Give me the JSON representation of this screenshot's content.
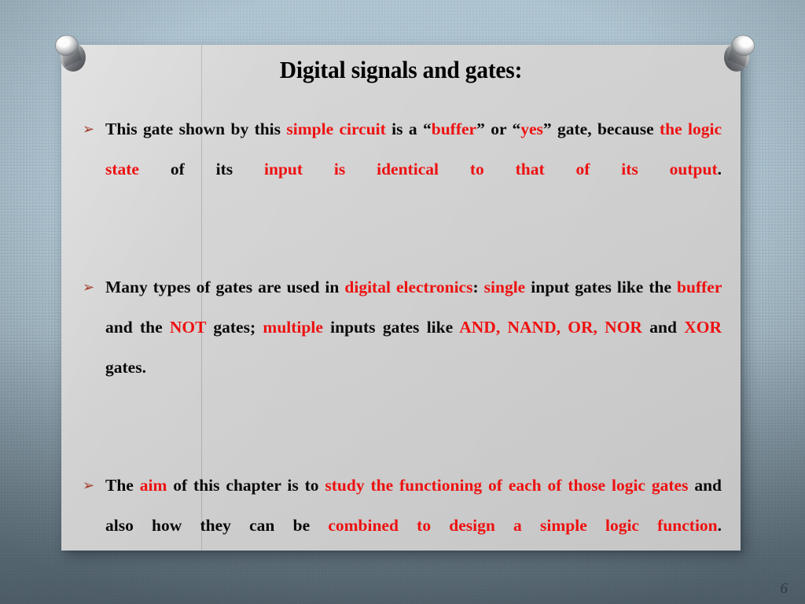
{
  "slide": {
    "title": "Digital signals and gates:",
    "page_number": "6",
    "panel_color": "#cfcfcf",
    "background_color": "#a9c0cd",
    "accent_red": "#ee1111",
    "bullet_marker": "➢",
    "bullet_marker_color": "#a33a28"
  },
  "bullets": [
    {
      "id": "bullet-1",
      "plain": "This gate shown by this simple circuit is a “buffer” or “yes” gate, because the logic state of its input is identical to that of its output.",
      "runs": [
        {
          "text": "This gate shown by this ",
          "color": "black"
        },
        {
          "text": "simple circuit",
          "color": "red"
        },
        {
          "text": " is a “",
          "color": "black"
        },
        {
          "text": "buffer",
          "color": "red"
        },
        {
          "text": "” or “",
          "color": "black"
        },
        {
          "text": "yes",
          "color": "red"
        },
        {
          "text": "” gate, because ",
          "color": "black"
        },
        {
          "text": "the logic state",
          "color": "red"
        },
        {
          "text": " of its ",
          "color": "black"
        },
        {
          "text": "input is identical to that of its output",
          "color": "red"
        },
        {
          "text": ".",
          "color": "black"
        }
      ]
    },
    {
      "id": "bullet-2",
      "plain": "Many types of gates are used in digital electronics: single input gates like the buffer and the NOT gates; multiple inputs gates like AND, NAND, OR, NOR and XOR gates.",
      "runs": [
        {
          "text": " Many types of gates are used in ",
          "color": "black"
        },
        {
          "text": "digital electronics",
          "color": "red"
        },
        {
          "text": ": ",
          "color": "black"
        },
        {
          "text": "single",
          "color": "red"
        },
        {
          "text": " input gates like the ",
          "color": "black"
        },
        {
          "text": "buffer",
          "color": "red"
        },
        {
          "text": " and the ",
          "color": "black"
        },
        {
          "text": "NOT",
          "color": "red"
        },
        {
          "text": " gates; ",
          "color": "black"
        },
        {
          "text": "multiple",
          "color": "red"
        },
        {
          "text": " inputs gates like ",
          "color": "black"
        },
        {
          "text": "AND, NAND, OR, NOR",
          "color": "red"
        },
        {
          "text": " and ",
          "color": "black"
        },
        {
          "text": "XOR",
          "color": "red"
        },
        {
          "text": " gates.",
          "color": "black"
        }
      ]
    },
    {
      "id": "bullet-3",
      "plain": "The aim of this chapter is to study the functioning of each of those logic gates and also how they can be combined to design a simple logic function.",
      "runs": [
        {
          "text": "The ",
          "color": "black"
        },
        {
          "text": "aim",
          "color": "red"
        },
        {
          "text": " of this chapter is to ",
          "color": "black"
        },
        {
          "text": "study the functioning of each of those logic gates",
          "color": "red"
        },
        {
          "text": " and also how they can be ",
          "color": "black"
        },
        {
          "text": "combined to design a simple logic function",
          "color": "red"
        },
        {
          "text": ".",
          "color": "black"
        }
      ]
    }
  ],
  "decorations": {
    "pin_left_name": "metal pin",
    "pin_right_name": "metal pin"
  }
}
